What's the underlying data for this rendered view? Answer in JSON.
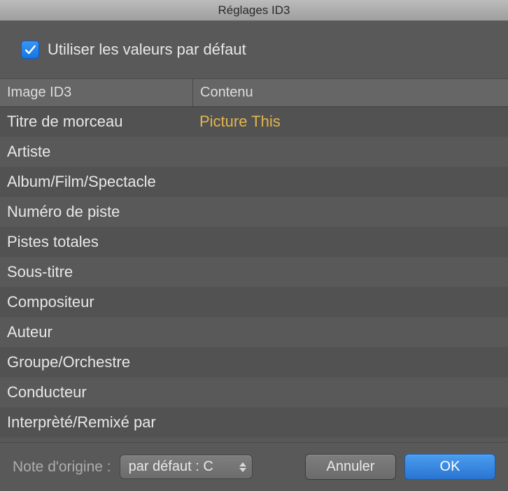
{
  "window": {
    "title": "Réglages ID3"
  },
  "defaults": {
    "checkbox_label": "Utiliser les valeurs par défaut",
    "checked": true
  },
  "table": {
    "header_image": "Image ID3",
    "header_content": "Contenu",
    "rows": [
      {
        "label": "Titre de morceau",
        "value": "Picture This"
      },
      {
        "label": "Artiste",
        "value": ""
      },
      {
        "label": "Album/Film/Spectacle",
        "value": ""
      },
      {
        "label": "Numéro de piste",
        "value": ""
      },
      {
        "label": "Pistes totales",
        "value": ""
      },
      {
        "label": "Sous-titre",
        "value": ""
      },
      {
        "label": "Compositeur",
        "value": ""
      },
      {
        "label": "Auteur",
        "value": ""
      },
      {
        "label": "Groupe/Orchestre",
        "value": ""
      },
      {
        "label": "Conducteur",
        "value": ""
      },
      {
        "label": "Interprèté/Remixé par",
        "value": ""
      }
    ]
  },
  "footer": {
    "note_label": "Note d'origine :",
    "select_value": "par défaut : C",
    "cancel_label": "Annuler",
    "ok_label": "OK"
  }
}
